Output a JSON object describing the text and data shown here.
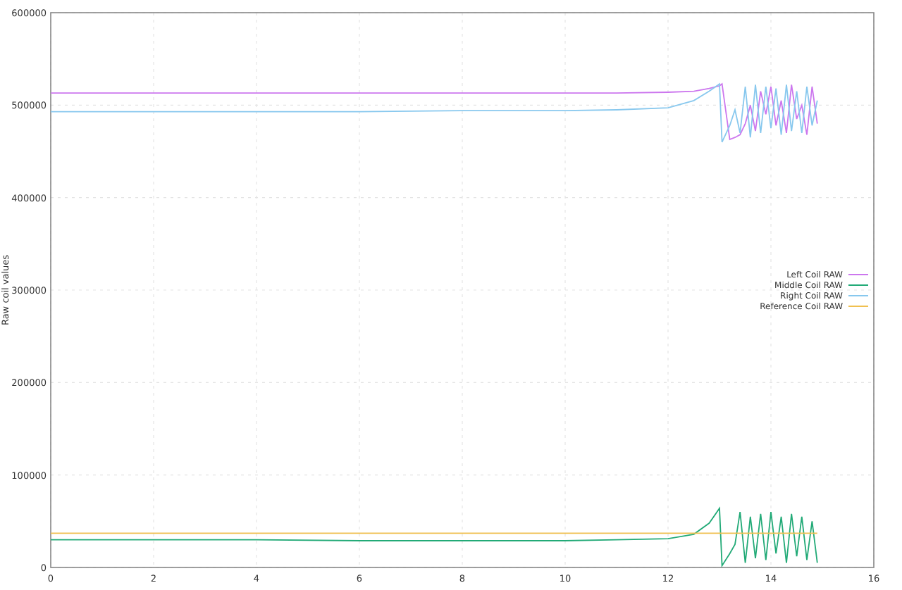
{
  "chart_data": {
    "type": "line",
    "ylabel": "Raw coil values",
    "x": [
      0,
      2,
      4,
      6,
      8,
      10,
      11,
      12,
      12.5,
      12.8,
      13.0,
      13.05,
      13.2,
      13.3,
      13.4,
      13.5,
      13.6,
      13.7,
      13.8,
      13.9,
      14.0,
      14.1,
      14.2,
      14.3,
      14.4,
      14.5,
      14.6,
      14.7,
      14.8,
      14.9
    ],
    "xlim": [
      0,
      16
    ],
    "grid": true,
    "legend": true,
    "ylim": [
      0,
      600000
    ],
    "xticks": [
      0,
      2,
      4,
      6,
      8,
      10,
      12,
      14,
      16
    ],
    "yticks": [
      0,
      100000,
      200000,
      300000,
      400000,
      500000,
      600000
    ],
    "series": [
      {
        "name": "Left Coil RAW",
        "color": "#cc77ee",
        "values": [
          513000,
          513000,
          513000,
          513000,
          513000,
          513000,
          513000,
          514000,
          515000,
          518000,
          521000,
          523000,
          463000,
          465000,
          468000,
          480000,
          500000,
          472000,
          515000,
          490000,
          520000,
          478000,
          505000,
          470000,
          522000,
          485000,
          500000,
          468000,
          520000,
          480000
        ]
      },
      {
        "name": "Middle Coil RAW",
        "color": "#22aa77",
        "values": [
          30000,
          30000,
          30000,
          29000,
          29000,
          29000,
          30000,
          31000,
          36000,
          48000,
          64000,
          2000,
          15000,
          25000,
          60000,
          5000,
          55000,
          10000,
          58000,
          8000,
          60000,
          15000,
          55000,
          5000,
          58000,
          12000,
          55000,
          8000,
          50000,
          5000
        ]
      },
      {
        "name": "Right Coil RAW",
        "color": "#88c8ee",
        "values": [
          493000,
          493000,
          493000,
          493000,
          494000,
          494000,
          495000,
          497000,
          505000,
          515000,
          523000,
          460000,
          478000,
          495000,
          470000,
          520000,
          465000,
          522000,
          470000,
          520000,
          475000,
          518000,
          468000,
          522000,
          472000,
          515000,
          470000,
          520000,
          478000,
          505000
        ]
      },
      {
        "name": "Reference Coil RAW",
        "color": "#f0c050",
        "values": [
          37000,
          37000,
          37000,
          37000,
          37000,
          37000,
          37000,
          37000,
          37000,
          37000,
          37000,
          37000,
          37000,
          37000,
          37000,
          37000,
          37000,
          37000,
          37000,
          37000,
          37000,
          37000,
          37000,
          37000,
          37000,
          37000,
          37000,
          37000,
          37000,
          37000
        ]
      }
    ]
  }
}
